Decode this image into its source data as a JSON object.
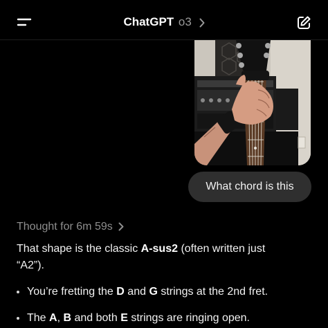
{
  "header": {
    "menu_icon": "hamburger-menu-icon",
    "brand": "ChatGPT",
    "model": "o3",
    "model_chevron_icon": "chevron-right-icon",
    "new_chat_icon": "edit-pencil-icon"
  },
  "user_message": {
    "image_alt": "photo-of-hand-fretting-guitar",
    "text": "What chord is this"
  },
  "assistant": {
    "thought_label": "Thought for 6m 59s",
    "thought_chevron_icon": "chevron-right-icon",
    "intro_part1": "That shape is the classic ",
    "chord_name": "A-sus2",
    "intro_part2": " (often written just",
    "intro_line2": "“A2”).",
    "bullets": [
      {
        "p1": "You’re fretting the ",
        "b1": "D",
        "p2": " and ",
        "b2": "G",
        "p3": " strings at the 2nd fret."
      },
      {
        "p1": "The ",
        "b1": "A",
        "p2": ", ",
        "b2": "B",
        "p3": " and both ",
        "b3": "E",
        "p4": " strings are ringing open."
      }
    ]
  },
  "colors": {
    "background": "#000000",
    "bubble": "#2f2f2f",
    "muted_text": "#8e8e8e"
  }
}
